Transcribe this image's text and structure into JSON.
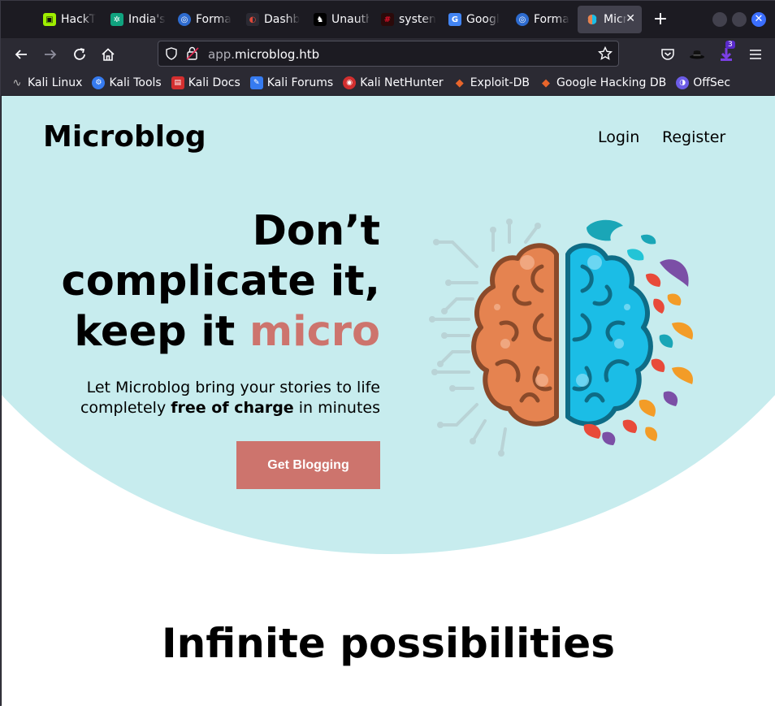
{
  "browser": {
    "tabs": [
      {
        "title": "HackT",
        "favicon_color": "#9fef00",
        "favicon_glyph": "cube-icon"
      },
      {
        "title": "India's",
        "favicon_color": "#10a37f",
        "favicon_glyph": "openai-icon"
      },
      {
        "title": "Forma",
        "favicon_color": "#2d6bcf",
        "favicon_glyph": "globe-icon"
      },
      {
        "title": "Dashb",
        "favicon_color": "#e0493a",
        "favicon_glyph": "dashboard-icon"
      },
      {
        "title": "Unauth",
        "favicon_color": "#000000",
        "favicon_glyph": "mask-icon"
      },
      {
        "title": "systen",
        "favicon_color": "#c0102a",
        "favicon_glyph": "hash-icon"
      },
      {
        "title": "Googl",
        "favicon_color": "#4285f4",
        "favicon_glyph": "translate-icon"
      },
      {
        "title": "Forma",
        "favicon_color": "#2d6bcf",
        "favicon_glyph": "globe-icon"
      },
      {
        "title": "Micr",
        "favicon_color": "#e0493a",
        "favicon_glyph": "brain-icon",
        "active": true
      }
    ],
    "url": {
      "subdomain": "app.",
      "domain": "microblog.htb"
    },
    "extension_badge": "3",
    "bookmarks": [
      {
        "label": "Kali Linux",
        "icon": "kali-dragon-icon",
        "color": "#367bf0"
      },
      {
        "label": "Kali Tools",
        "icon": "kali-tools-icon",
        "color": "#367bf0"
      },
      {
        "label": "Kali Docs",
        "icon": "kali-docs-icon",
        "color": "#d32f2f"
      },
      {
        "label": "Kali Forums",
        "icon": "kali-forums-icon",
        "color": "#367bf0"
      },
      {
        "label": "Kali NetHunter",
        "icon": "nethunter-icon",
        "color": "#d32f2f"
      },
      {
        "label": "Exploit-DB",
        "icon": "exploitdb-icon",
        "color": "#e8652b"
      },
      {
        "label": "Google Hacking DB",
        "icon": "ghdb-icon",
        "color": "#e8652b"
      },
      {
        "label": "OffSec",
        "icon": "offsec-icon",
        "color": "#6c5ce7"
      }
    ]
  },
  "site": {
    "brand": "Microblog",
    "nav": {
      "login": "Login",
      "register": "Register"
    },
    "headline": {
      "line1": "Don’t",
      "line2": "complicate it,",
      "line3_prefix": "keep it ",
      "line3_accent": "micro"
    },
    "tagline": {
      "line1": "Let Microblog bring your stories to life",
      "line2_prefix": "completely ",
      "line2_bold": "free of charge",
      "line2_suffix": " in minutes"
    },
    "cta": "Get Blogging",
    "section_title": "Infinite possibilities",
    "colors": {
      "hero_bg": "#c7ecee",
      "accent": "#cd746d",
      "brain_left": "#e58350",
      "brain_right": "#1bbde6"
    }
  }
}
